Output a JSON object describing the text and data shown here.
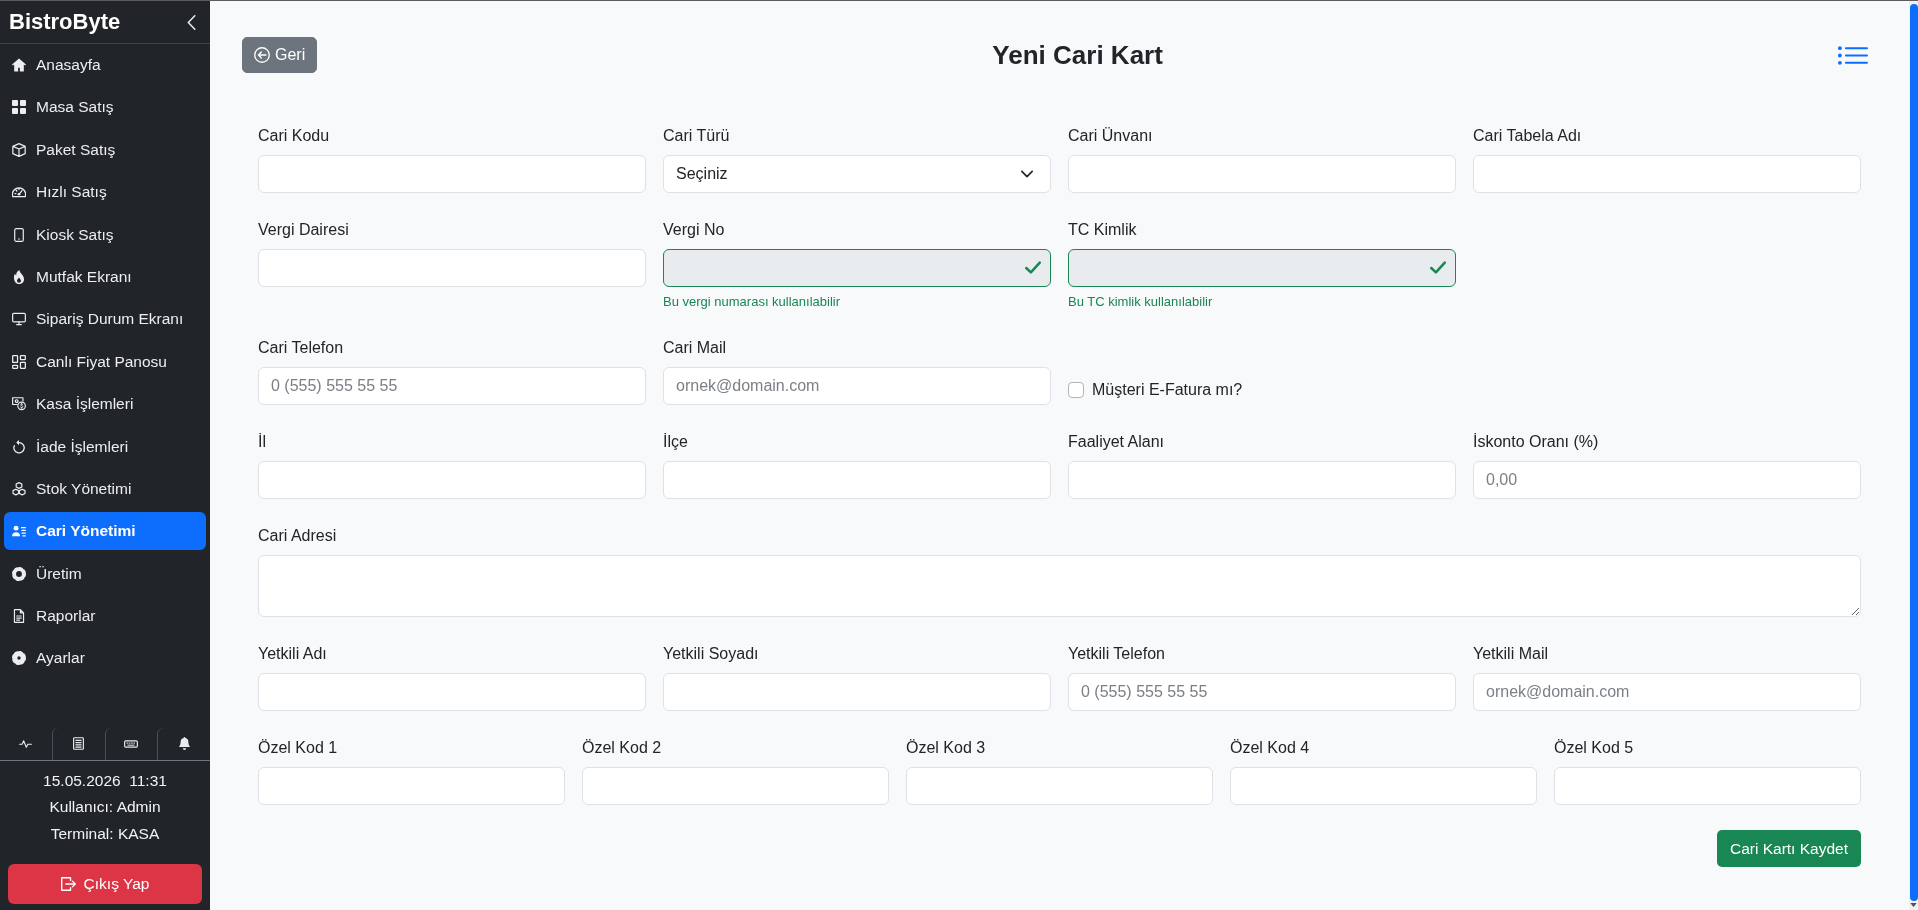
{
  "sidebar": {
    "brand": "BistroByte",
    "items": [
      {
        "label": "Anasayfa",
        "selected": false
      },
      {
        "label": "Masa Satış",
        "selected": false
      },
      {
        "label": "Paket Satış",
        "selected": false
      },
      {
        "label": "Hızlı Satış",
        "selected": false
      },
      {
        "label": "Kiosk Satış",
        "selected": false
      },
      {
        "label": "Mutfak Ekranı",
        "selected": false
      },
      {
        "label": "Sipariş Durum Ekranı",
        "selected": false
      },
      {
        "label": "Canlı Fiyat Panosu",
        "selected": false
      },
      {
        "label": "Kasa İşlemleri",
        "selected": false
      },
      {
        "label": "İade İşlemleri",
        "selected": false
      },
      {
        "label": "Stok Yönetimi",
        "selected": false
      },
      {
        "label": "Cari Yönetimi",
        "selected": true
      },
      {
        "label": "Üretim",
        "selected": false
      },
      {
        "label": "Raporlar",
        "selected": false
      },
      {
        "label": "Ayarlar",
        "selected": false
      }
    ],
    "status": {
      "datetime": "15.05.2026  11:31",
      "user": "Kullanıcı: Admin",
      "terminal": "Terminal: KASA"
    },
    "logout_button": "Çıkış Yap"
  },
  "header": {
    "back_button": "Geri",
    "title": "Yeni Cari Kart"
  },
  "form": {
    "rows": [
      {
        "fields": [
          {
            "kind": "text",
            "label": "Cari Kodu",
            "valid": false,
            "disabled": false
          },
          {
            "kind": "select",
            "label": "Cari Türü",
            "value": "Seçiniz",
            "valid": false,
            "disabled": false
          },
          {
            "kind": "text",
            "label": "Cari Ünvanı",
            "valid": false,
            "disabled": false
          },
          {
            "kind": "text",
            "label": "Cari Tabela Adı",
            "valid": false,
            "disabled": false
          }
        ]
      },
      {
        "fields": [
          {
            "kind": "text",
            "label": "Vergi Dairesi",
            "valid": false,
            "disabled": false
          },
          {
            "kind": "text",
            "label": "Vergi No",
            "valid": true,
            "disabled": true,
            "feedback": "Bu vergi numarası kullanılabilir"
          },
          {
            "kind": "text",
            "label": "TC Kimlik",
            "valid": true,
            "disabled": true,
            "feedback": "Bu TC kimlik kullanılabilir"
          }
        ]
      },
      {
        "fields": [
          {
            "kind": "text",
            "label": "Cari Telefon",
            "placeholder": "0 (555) 555 55 55",
            "valid": false,
            "disabled": false
          },
          {
            "kind": "text",
            "label": "Cari Mail",
            "placeholder": "ornek@domain.com",
            "valid": false,
            "disabled": false
          },
          {
            "kind": "checkbox",
            "label": "Müşteri E-Fatura mı?",
            "checked": false,
            "valid": false,
            "disabled": false
          }
        ]
      },
      {
        "fields": [
          {
            "kind": "text",
            "label": "İl",
            "valid": false,
            "disabled": false
          },
          {
            "kind": "text",
            "label": "İlçe",
            "valid": false,
            "disabled": false
          },
          {
            "kind": "text",
            "label": "Faaliyet Alanı",
            "valid": false,
            "disabled": false
          },
          {
            "kind": "text",
            "label": "İskonto Oranı (%)",
            "placeholder": "0,00",
            "valid": false,
            "disabled": false
          }
        ]
      },
      {
        "fields": [
          {
            "kind": "textarea",
            "label": "Cari Adresi",
            "valid": false,
            "disabled": false
          }
        ]
      },
      {
        "fields": [
          {
            "kind": "text",
            "label": "Yetkili Adı",
            "valid": false,
            "disabled": false
          },
          {
            "kind": "text",
            "label": "Yetkili Soyadı",
            "valid": false,
            "disabled": false
          },
          {
            "kind": "text",
            "label": "Yetkili Telefon",
            "placeholder": "0 (555) 555 55 55",
            "valid": false,
            "disabled": false
          },
          {
            "kind": "text",
            "label": "Yetkili Mail",
            "placeholder": "ornek@domain.com",
            "valid": false,
            "disabled": false
          }
        ]
      },
      {
        "fields": [
          {
            "kind": "text",
            "label": "Özel Kod 1",
            "valid": false,
            "disabled": false
          },
          {
            "kind": "text",
            "label": "Özel Kod 2",
            "valid": false,
            "disabled": false
          },
          {
            "kind": "text",
            "label": "Özel Kod 3",
            "valid": false,
            "disabled": false
          },
          {
            "kind": "text",
            "label": "Özel Kod 4",
            "valid": false,
            "disabled": false
          },
          {
            "kind": "text",
            "label": "Özel Kod 5",
            "valid": false,
            "disabled": false
          }
        ]
      }
    ],
    "submit_button": "Cari Kartı Kaydet"
  }
}
